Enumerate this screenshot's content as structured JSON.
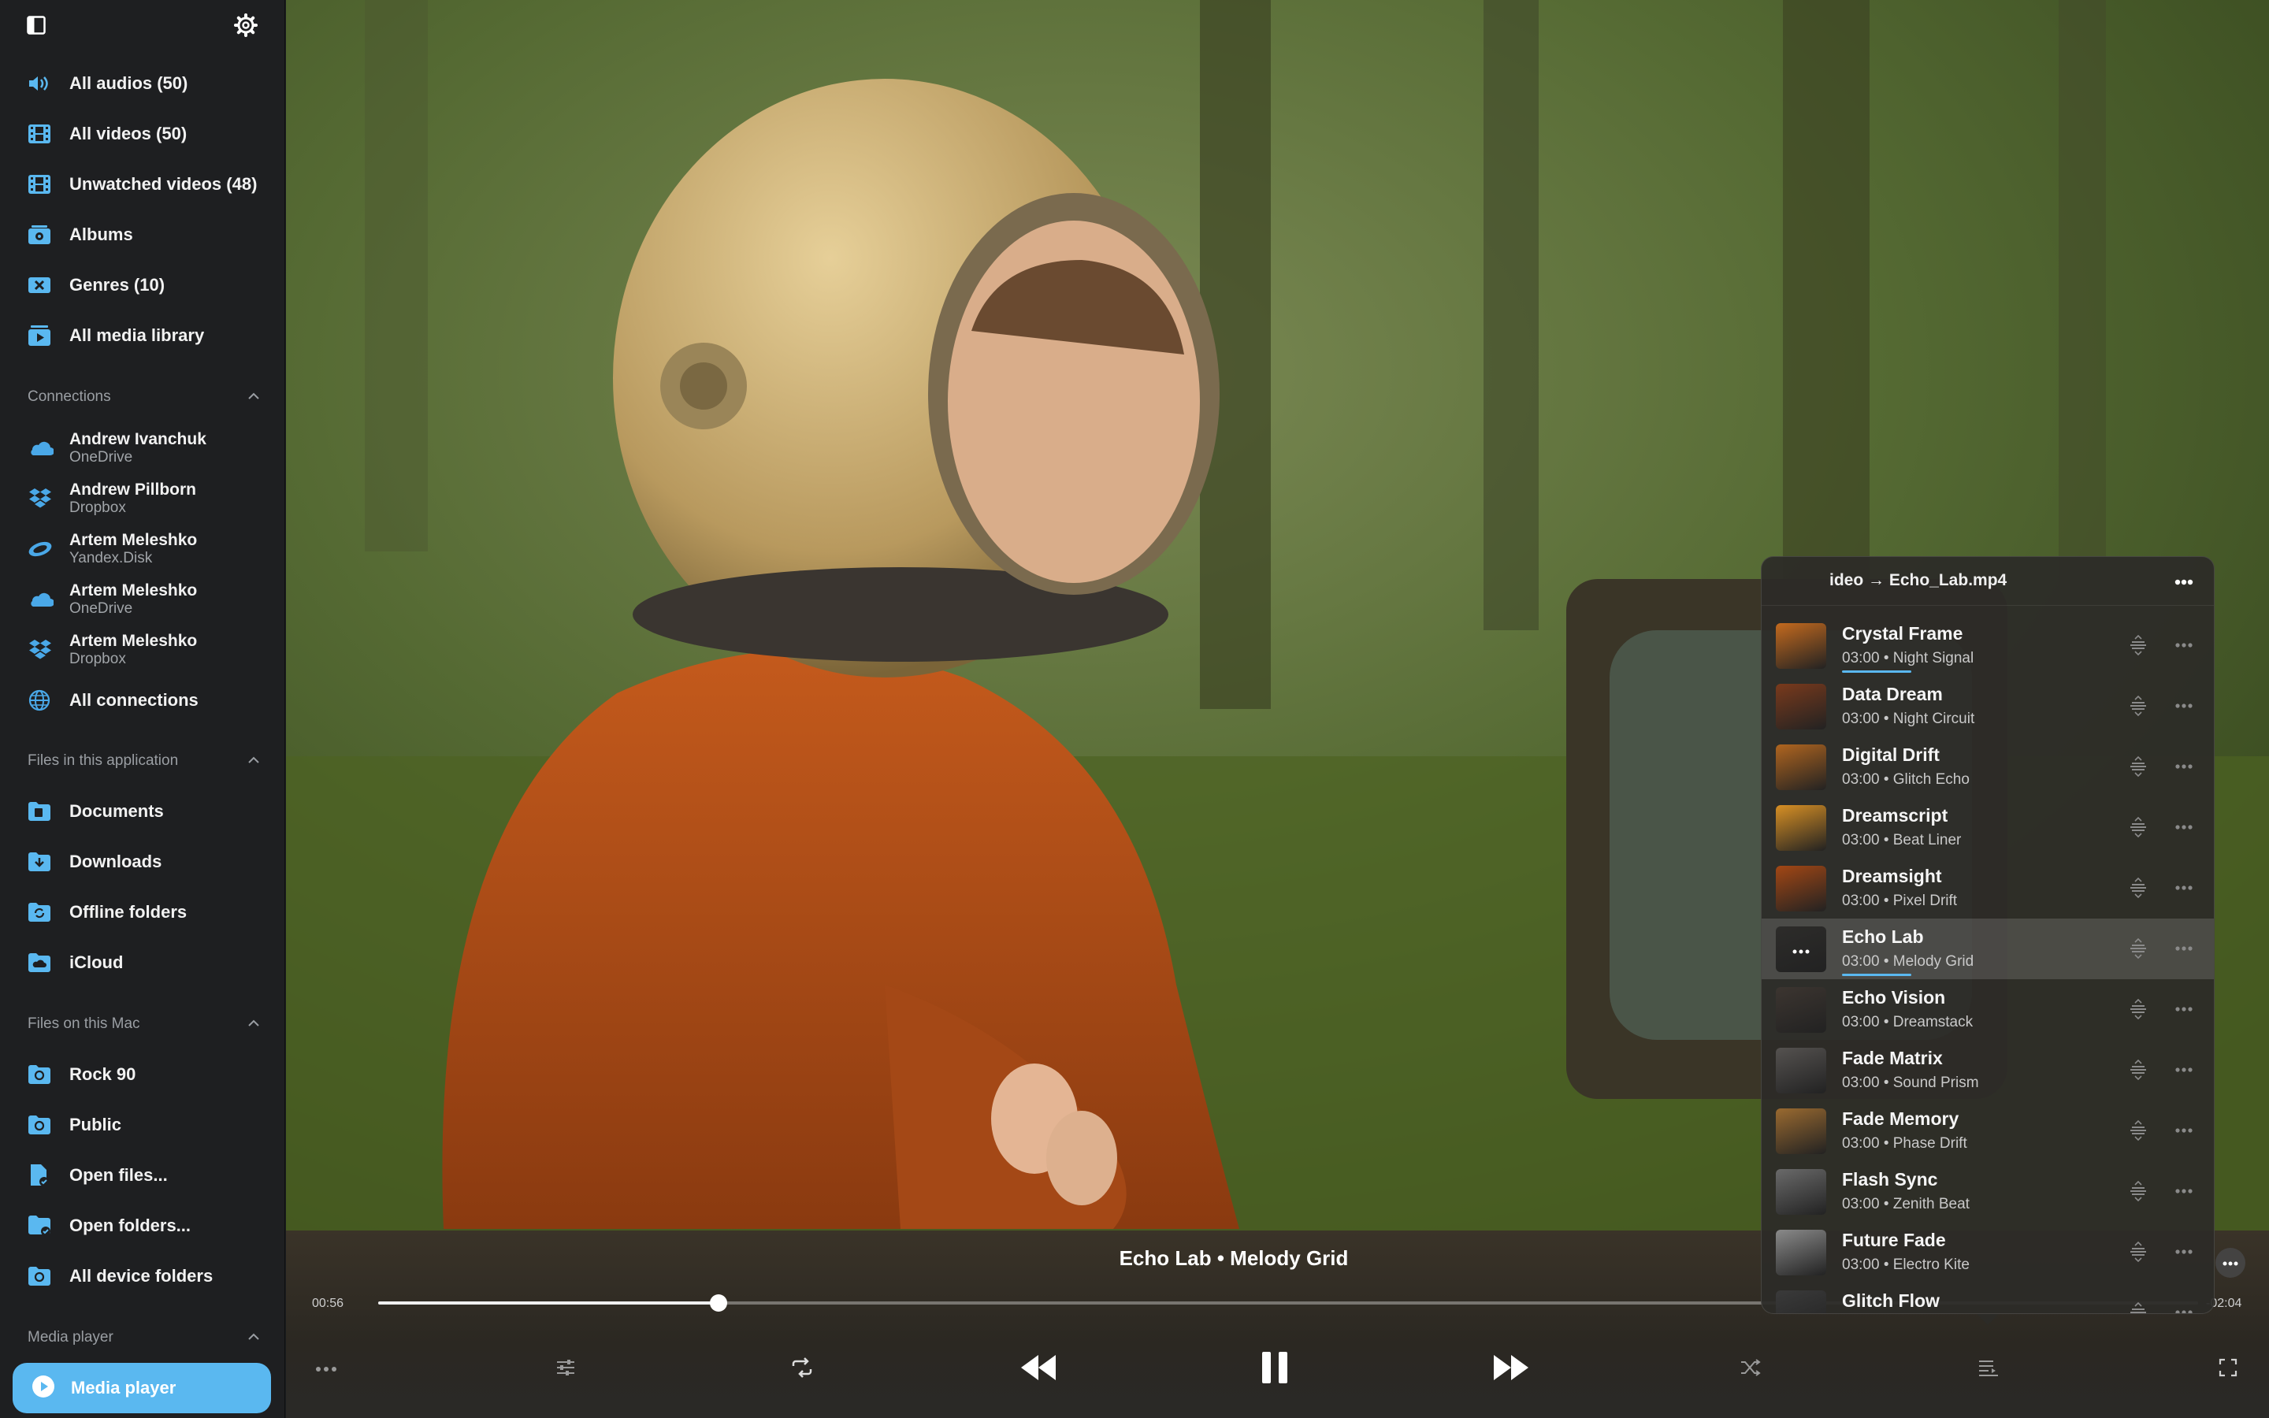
{
  "sidebar": {
    "library": [
      {
        "label": "All audios (50)",
        "icon": "audio-wave-icon"
      },
      {
        "label": "All videos (50)",
        "icon": "film-icon"
      },
      {
        "label": "Unwatched videos (48)",
        "icon": "film-icon"
      },
      {
        "label": "Albums",
        "icon": "albums-icon"
      },
      {
        "label": "Genres (10)",
        "icon": "genres-icon"
      },
      {
        "label": "All media library",
        "icon": "media-library-icon"
      }
    ],
    "connections_header": "Connections",
    "connections": [
      {
        "name": "Andrew Ivanchuk",
        "service": "OneDrive",
        "icon": "onedrive-icon"
      },
      {
        "name": "Andrew Pillborn",
        "service": "Dropbox",
        "icon": "dropbox-icon"
      },
      {
        "name": "Artem Meleshko",
        "service": "Yandex.Disk",
        "icon": "yandex-disk-icon"
      },
      {
        "name": "Artem Meleshko",
        "service": "OneDrive",
        "icon": "onedrive-icon"
      },
      {
        "name": "Artem Meleshko",
        "service": "Dropbox",
        "icon": "dropbox-icon"
      }
    ],
    "all_connections": "All connections",
    "app_files_header": "Files in this application",
    "app_files": [
      {
        "label": "Documents",
        "icon": "folder-icon"
      },
      {
        "label": "Downloads",
        "icon": "download-folder-icon"
      },
      {
        "label": "Offline folders",
        "icon": "sync-folder-icon"
      },
      {
        "label": "iCloud",
        "icon": "icloud-folder-icon"
      }
    ],
    "mac_files_header": "Files on this Mac",
    "mac_files": [
      {
        "label": "Rock 90",
        "icon": "disk-folder-icon"
      },
      {
        "label": "Public",
        "icon": "disk-folder-icon"
      },
      {
        "label": "Open files...",
        "icon": "open-file-icon"
      },
      {
        "label": "Open folders...",
        "icon": "open-folder-icon"
      },
      {
        "label": "All device folders",
        "icon": "disk-folder-icon"
      }
    ],
    "media_header": "Media player",
    "media_player_button": "Media player"
  },
  "player": {
    "now_playing": "Echo Lab • Melody Grid",
    "elapsed": "00:56",
    "remaining": "-02:04",
    "progress_fraction": 0.187
  },
  "playlist": {
    "path": "ideo → Echo_Lab.mp4",
    "items": [
      {
        "title": "Crystal Frame",
        "sub": "03:00 • Night Signal",
        "thumb": "#c46a1e",
        "progress": true
      },
      {
        "title": "Data Dream",
        "sub": "03:00 • Night Circuit",
        "thumb": "#7a3a1c",
        "progress": false
      },
      {
        "title": "Digital Drift",
        "sub": "03:00 • Glitch Echo",
        "thumb": "#b0651f",
        "progress": false
      },
      {
        "title": "Dreamscript",
        "sub": "03:00 • Beat Liner",
        "thumb": "#d89024",
        "progress": false
      },
      {
        "title": "Dreamsight",
        "sub": "03:00 • Pixel Drift",
        "thumb": "#a34714",
        "progress": false
      },
      {
        "title": "Echo Lab",
        "sub": "03:00 • Melody Grid",
        "thumb": "#2d2c2a",
        "progress": true,
        "active": true
      },
      {
        "title": "Echo Vision",
        "sub": "03:00 • Dreamstack",
        "thumb": "#3c3530",
        "progress": false
      },
      {
        "title": "Fade Matrix",
        "sub": "03:00 • Sound Prism",
        "thumb": "#555250",
        "progress": false
      },
      {
        "title": "Fade Memory",
        "sub": "03:00 • Phase Drift",
        "thumb": "#9a6a30",
        "progress": false
      },
      {
        "title": "Flash Sync",
        "sub": "03:00 • Zenith Beat",
        "thumb": "#6a6a6a",
        "progress": false
      },
      {
        "title": "Future Fade",
        "sub": "03:00 • Electro Kite",
        "thumb": "#8a8a8a",
        "progress": false
      },
      {
        "title": "Glitch Flow",
        "sub": "",
        "thumb": "#3a3a3a",
        "progress": false
      }
    ]
  },
  "colors": {
    "accent": "#5ab8f0",
    "sidebar_bg": "#1e1f21"
  }
}
